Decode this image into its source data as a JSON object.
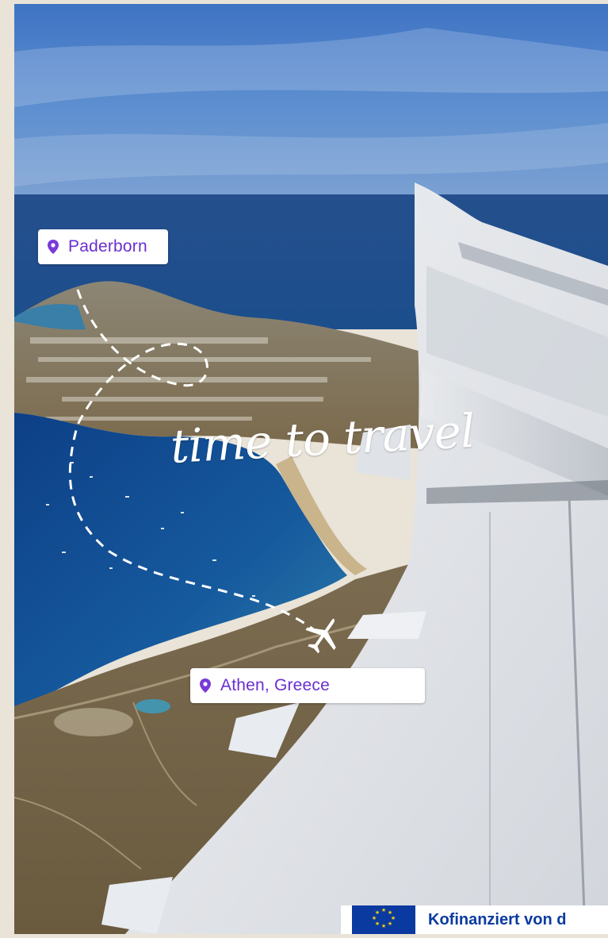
{
  "locations": {
    "origin": "Paderborn",
    "destination": "Athen, Greece"
  },
  "tagline": "time to travel",
  "footer": {
    "text": "Kofinanziert von d"
  },
  "colors": {
    "label_text": "#6a2fd0",
    "pin": "#7a3ad8",
    "eu_blue": "#0a3aa0",
    "eu_star": "#ffd400"
  },
  "icons": {
    "pin": "location-pin-icon",
    "plane": "airplane-icon",
    "flag": "eu-flag-icon"
  }
}
